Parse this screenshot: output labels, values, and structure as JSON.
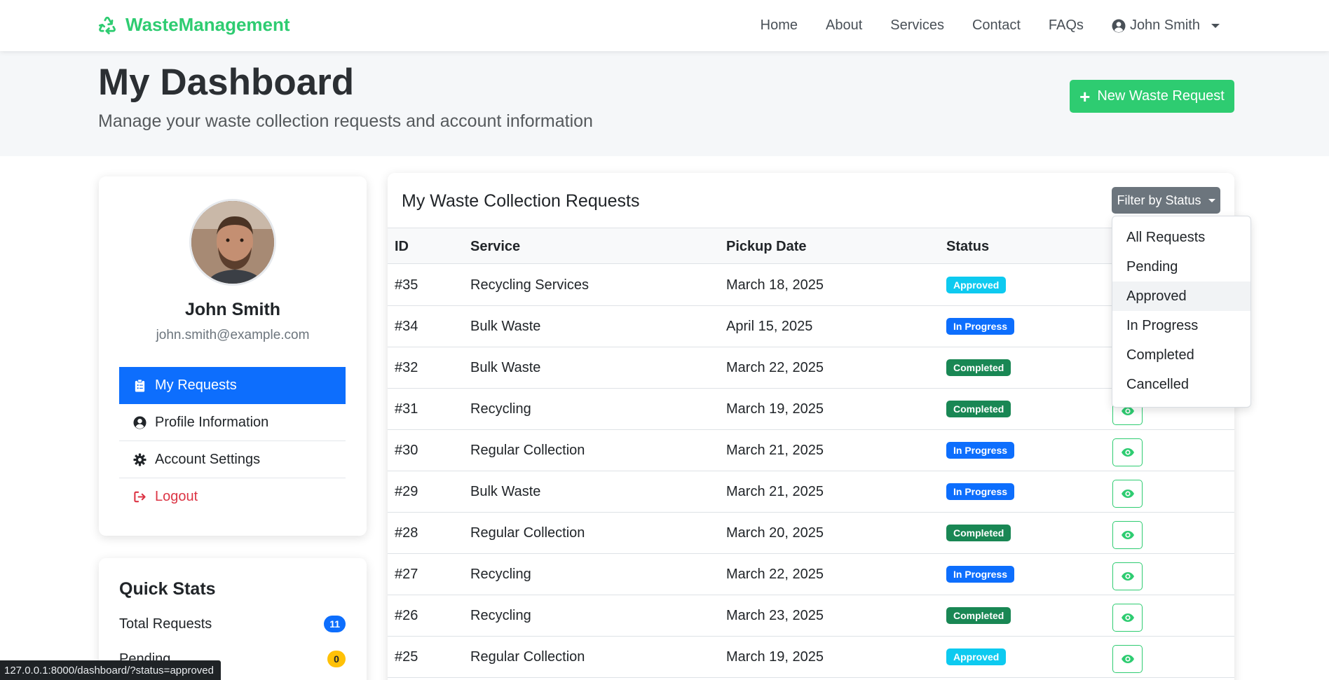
{
  "brand": {
    "name": "WasteManagement"
  },
  "nav": {
    "links": [
      "Home",
      "About",
      "Services",
      "Contact",
      "FAQs"
    ],
    "user": "John Smith"
  },
  "header": {
    "title": "My Dashboard",
    "subtitle": "Manage your waste collection requests and account information",
    "new_request_label": "New Waste Request"
  },
  "profile": {
    "name": "John Smith",
    "email": "john.smith@example.com",
    "menu": [
      {
        "label": "My Requests",
        "icon": "clipboard-icon"
      },
      {
        "label": "Profile Information",
        "icon": "user-circle-icon"
      },
      {
        "label": "Account Settings",
        "icon": "gear-icon"
      },
      {
        "label": "Logout",
        "icon": "logout-icon"
      }
    ]
  },
  "stats": {
    "title": "Quick Stats",
    "rows": [
      {
        "label": "Total Requests",
        "value": "11"
      },
      {
        "label": "Pending",
        "value": "0"
      }
    ]
  },
  "requests": {
    "title": "My Waste Collection Requests",
    "filter_label": "Filter by Status",
    "columns": [
      "ID",
      "Service",
      "Pickup Date",
      "Status"
    ],
    "rows": [
      {
        "id": "#35",
        "service": "Recycling Services",
        "date": "March 18, 2025",
        "status": "Approved"
      },
      {
        "id": "#34",
        "service": "Bulk Waste",
        "date": "April 15, 2025",
        "status": "In Progress"
      },
      {
        "id": "#32",
        "service": "Bulk Waste",
        "date": "March 22, 2025",
        "status": "Completed"
      },
      {
        "id": "#31",
        "service": "Recycling",
        "date": "March 19, 2025",
        "status": "Completed"
      },
      {
        "id": "#30",
        "service": "Regular Collection",
        "date": "March 21, 2025",
        "status": "In Progress"
      },
      {
        "id": "#29",
        "service": "Bulk Waste",
        "date": "March 21, 2025",
        "status": "In Progress"
      },
      {
        "id": "#28",
        "service": "Regular Collection",
        "date": "March 20, 2025",
        "status": "Completed"
      },
      {
        "id": "#27",
        "service": "Recycling",
        "date": "March 22, 2025",
        "status": "In Progress"
      },
      {
        "id": "#26",
        "service": "Recycling",
        "date": "March 23, 2025",
        "status": "Completed"
      },
      {
        "id": "#25",
        "service": "Regular Collection",
        "date": "March 19, 2025",
        "status": "Approved"
      }
    ]
  },
  "filter_dropdown": {
    "options": [
      "All Requests",
      "Pending",
      "Approved",
      "In Progress",
      "Completed",
      "Cancelled"
    ],
    "hovered": "Approved"
  },
  "statusbar": {
    "url": "127.0.0.1:8000/dashboard/?status=approved"
  },
  "colors": {
    "brand": "#2ecc71",
    "primary": "#0d6efd",
    "approved": "#0dcaf0",
    "in_progress": "#0d6efd",
    "completed": "#198754",
    "pending": "#ffc107",
    "danger": "#dc3545",
    "secondary": "#6c757d"
  }
}
